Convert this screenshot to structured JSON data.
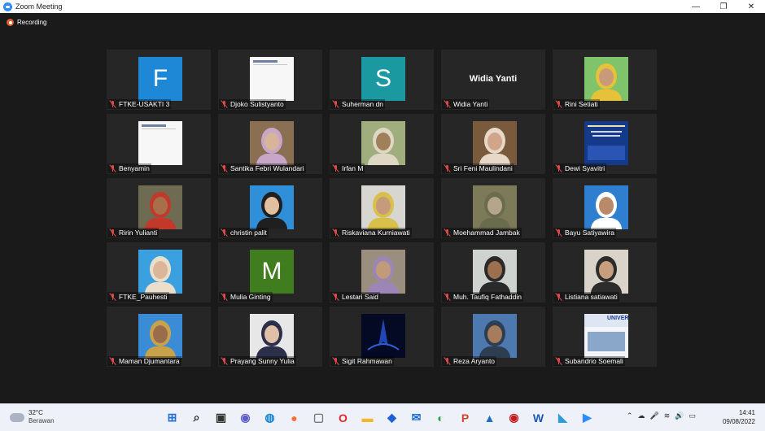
{
  "window": {
    "title": "Zoom Meeting",
    "minimize": "—",
    "maximize": "❐",
    "close": "✕"
  },
  "recording": {
    "label": "Recording"
  },
  "participants": [
    {
      "name": "FTKE-USAKTI 3",
      "avatar": {
        "type": "letter",
        "letter": "F",
        "color": "#1e88d6"
      }
    },
    {
      "name": "Djoko Sulistyanto",
      "avatar": {
        "type": "doc"
      }
    },
    {
      "name": "Suherman dn",
      "avatar": {
        "type": "letter",
        "letter": "S",
        "color": "#1a9aa0"
      }
    },
    {
      "name": "Widia Yanti",
      "avatar": {
        "type": "text",
        "text": "Widia Yanti"
      }
    },
    {
      "name": "Rini Setiati",
      "avatar": {
        "type": "photo",
        "bg": "#7fc36b",
        "face": "#c99a7a",
        "wrap": "#e6c23a"
      }
    },
    {
      "name": "Benyamin",
      "avatar": {
        "type": "doc"
      }
    },
    {
      "name": "Santika Febri Wulandari",
      "avatar": {
        "type": "photo",
        "bg": "#8b6f52",
        "face": "#d8b49a",
        "wrap": "#c8a6c8"
      }
    },
    {
      "name": "Irfan M",
      "avatar": {
        "type": "photo",
        "bg": "#9fae7c",
        "face": "#a0805a",
        "wrap": "#ddd7c4"
      }
    },
    {
      "name": "Sri Feni Maulindani",
      "avatar": {
        "type": "photo",
        "bg": "#7a5a3c",
        "face": "#d2a58a",
        "wrap": "#e7d8c8"
      }
    },
    {
      "name": "Dewi Syavitri",
      "avatar": {
        "type": "slide"
      }
    },
    {
      "name": "Ririn Yulianti",
      "avatar": {
        "type": "photo",
        "bg": "#6f6a52",
        "face": "#a8704a",
        "wrap": "#c0392b"
      }
    },
    {
      "name": "christin palit",
      "avatar": {
        "type": "photo",
        "bg": "#2f8fd8",
        "face": "#e2bf9f",
        "wrap": "#1f1f1f"
      }
    },
    {
      "name": "Riskaviana Kurniawati",
      "avatar": {
        "type": "photo",
        "bg": "#d8d6d0",
        "face": "#c59b7c",
        "wrap": "#d8c04a"
      }
    },
    {
      "name": "Moehammad Jambak",
      "avatar": {
        "type": "photo",
        "bg": "#7d7a5a",
        "face": "#b5a58a",
        "wrap": "#6a6c4e"
      }
    },
    {
      "name": "Bayu Satiyawira",
      "avatar": {
        "type": "photo",
        "bg": "#2e7fd0",
        "face": "#b88a6a",
        "wrap": "#ffffff"
      }
    },
    {
      "name": "FTKE_Pauhesti",
      "avatar": {
        "type": "photo",
        "bg": "#3aa0e0",
        "face": "#dcb698",
        "wrap": "#eadfca"
      }
    },
    {
      "name": "Mulia Ginting",
      "avatar": {
        "type": "letter",
        "letter": "M",
        "color": "#3f7d1f"
      }
    },
    {
      "name": "Lestari Said",
      "avatar": {
        "type": "photo",
        "bg": "#9a8f7e",
        "face": "#c19a7a",
        "wrap": "#9c86b8"
      }
    },
    {
      "name": "Muh. Taufiq Fathaddin",
      "avatar": {
        "type": "photo",
        "bg": "#cfd3cf",
        "face": "#9c6f4e",
        "wrap": "#2a2a2a"
      }
    },
    {
      "name": "Listiana satiawati",
      "avatar": {
        "type": "photo",
        "bg": "#d9d3c9",
        "face": "#c99e7e",
        "wrap": "#2c2c2c"
      }
    },
    {
      "name": "Maman Djumantara",
      "avatar": {
        "type": "photo",
        "bg": "#3b8cd6",
        "face": "#9b6c4c",
        "wrap": "#c8a24a"
      }
    },
    {
      "name": "Prayang Sunny Yulia",
      "avatar": {
        "type": "photo",
        "bg": "#e7e7e7",
        "face": "#e0c0a6",
        "wrap": "#2b2f4a"
      }
    },
    {
      "name": "Sigit Rahmawan",
      "avatar": {
        "type": "logo"
      }
    },
    {
      "name": "Reza Aryanto",
      "avatar": {
        "type": "photo",
        "bg": "#4d78b0",
        "face": "#a57c5c",
        "wrap": "#2d3e52"
      }
    },
    {
      "name": "Subandrio Soemali",
      "avatar": {
        "type": "univ",
        "text": "UNIVERS"
      }
    }
  ],
  "taskbar": {
    "weather": {
      "temp": "32°C",
      "condition": "Berawan"
    },
    "apps": [
      {
        "name": "start",
        "glyph": "⊞",
        "color": "#1f6fd6"
      },
      {
        "name": "search",
        "glyph": "⌕",
        "color": "#222222"
      },
      {
        "name": "task-view",
        "glyph": "▣",
        "color": "#333333"
      },
      {
        "name": "teams",
        "glyph": "◉",
        "color": "#5b5fc7"
      },
      {
        "name": "edge",
        "glyph": "◍",
        "color": "#1487d6"
      },
      {
        "name": "firefox",
        "glyph": "●",
        "color": "#ff7139"
      },
      {
        "name": "file",
        "glyph": "▢",
        "color": "#777777"
      },
      {
        "name": "opera",
        "glyph": "O",
        "color": "#e0262b"
      },
      {
        "name": "explorer",
        "glyph": "▬",
        "color": "#f2b728"
      },
      {
        "name": "dropbox",
        "glyph": "◆",
        "color": "#1d5fd6"
      },
      {
        "name": "mail",
        "glyph": "✉",
        "color": "#1f6fd6"
      },
      {
        "name": "chrome",
        "glyph": "◐",
        "color": "#2e9d4c"
      },
      {
        "name": "powerpoint",
        "glyph": "P",
        "color": "#d2452b"
      },
      {
        "name": "photos",
        "glyph": "▲",
        "color": "#1b6fc8"
      },
      {
        "name": "recorder",
        "glyph": "◉",
        "color": "#c21d1d"
      },
      {
        "name": "word",
        "glyph": "W",
        "color": "#1d58b8"
      },
      {
        "name": "maps",
        "glyph": "◣",
        "color": "#2f9bd9"
      },
      {
        "name": "zoom",
        "glyph": "▶",
        "color": "#2d8cff"
      }
    ],
    "tray": [
      "⌃",
      "☁",
      "🎤",
      "≋",
      "🔊",
      "▭"
    ],
    "time": "14:41",
    "date": "09/08/2022"
  }
}
